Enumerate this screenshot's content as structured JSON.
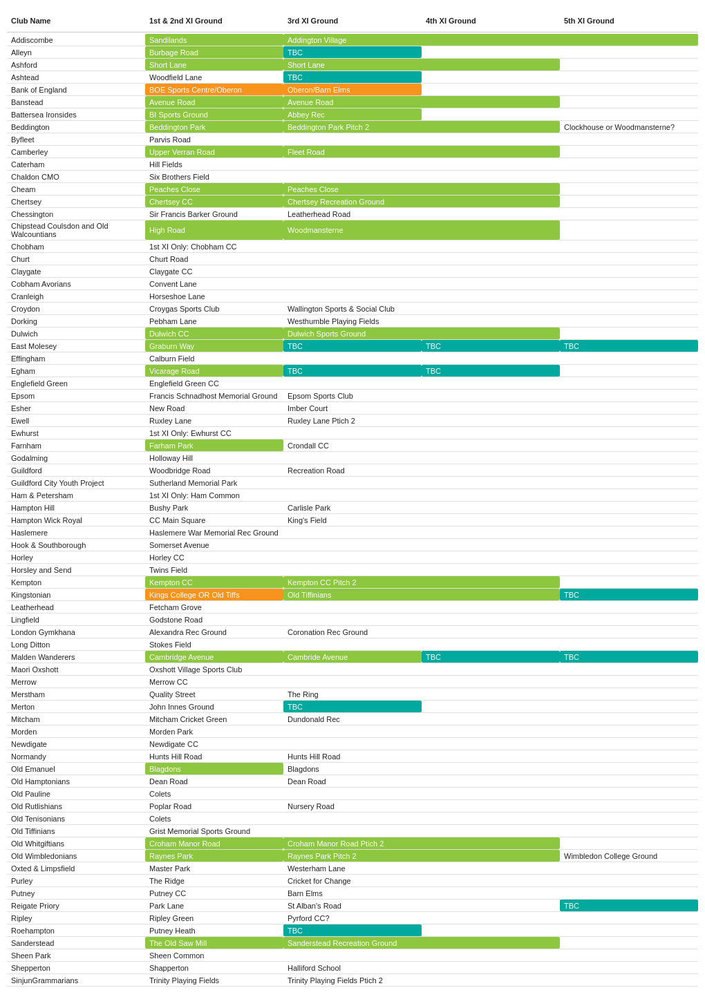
{
  "header": {
    "col1": "Club Name",
    "col2": "1st & 2nd XI Ground",
    "col3": "3rd XI Ground",
    "col4": "4th XI Ground",
    "col5": "5th XI Ground"
  },
  "rows": [
    {
      "club": "Addiscombe",
      "g1": "Sandilands",
      "g1c": "green",
      "g2": "Addington Village",
      "g2c": "green",
      "g2span": 3
    },
    {
      "club": "Alleyn",
      "g1": "Burbage Road",
      "g1c": "green",
      "g2": "TBC",
      "g2c": "teal"
    },
    {
      "club": "Ashford",
      "g1": "Short Lane",
      "g1c": "green",
      "g2": "Short Lane",
      "g2c": "green",
      "g2span": 2
    },
    {
      "club": "Ashtead",
      "g1": "Woodfield Lane",
      "g2": "TBC",
      "g2c": "teal"
    },
    {
      "club": "Bank of England",
      "g1": "BOE Sports Centre/Oberon",
      "g1c": "orange",
      "g2": "Oberon/Barn Elms",
      "g2c": "orange"
    },
    {
      "club": "Banstead",
      "g1": "Avenue Road",
      "g1c": "green",
      "g2": "Avenue Road",
      "g2c": "green",
      "g2span": 2
    },
    {
      "club": "Battersea Ironsides",
      "g1": "BI Sports Ground",
      "g1c": "green",
      "g2": "Abbey Rec",
      "g2c": "green"
    },
    {
      "club": "Beddington",
      "g1": "Beddington Park",
      "g1c": "green",
      "g2": "Beddington Park Pitch 2",
      "g2c": "green",
      "g2span": 2,
      "g3": "Clockhouse or Woodmansterne?",
      "g3c": ""
    },
    {
      "club": "Byfleet",
      "g1": "Parvis Road"
    },
    {
      "club": "Camberley",
      "g1": "Upper Verran Road",
      "g1c": "green",
      "g2": "Fleet Road",
      "g2c": "green",
      "g2span": 2
    },
    {
      "club": "Caterham",
      "g1": "Hill Fields"
    },
    {
      "club": "Chaldon CMO",
      "g1": "Six Brothers Field"
    },
    {
      "club": "Cheam",
      "g1": "Peaches Close",
      "g1c": "green",
      "g2": "Peaches Close",
      "g2c": "green",
      "g2span": 2
    },
    {
      "club": "Chertsey",
      "g1": "Chertsey CC",
      "g1c": "green",
      "g2": "Chertsey Recreation Ground",
      "g2c": "green",
      "g2span": 2
    },
    {
      "club": "Chessington",
      "g1": "Sir Francis Barker Ground",
      "g2": "Leatherhead Road"
    },
    {
      "club": "Chipstead Coulsdon and Old Walcountians",
      "g1": "High Road",
      "g1c": "green",
      "g2": "Woodmansterne",
      "g2c": "green",
      "g2span": 2
    },
    {
      "club": "Chobham",
      "g1": "1st XI Only: Chobham CC"
    },
    {
      "club": "Churt",
      "g1": "Churt Road"
    },
    {
      "club": "Claygate",
      "g1": "Claygate CC"
    },
    {
      "club": "Cobham Avorians",
      "g1": "Convent Lane"
    },
    {
      "club": "Cranleigh",
      "g1": "Horseshoe Lane"
    },
    {
      "club": "Croydon",
      "g1": "Croygas Sports Club",
      "g2": "Wallington Sports & Social Club"
    },
    {
      "club": "Dorking",
      "g1": "Pebham Lane",
      "g2": "Westhumble Playing Fields"
    },
    {
      "club": "Dulwich",
      "g1": "Dulwich CC",
      "g1c": "green",
      "g2": "Dulwich Sports Ground",
      "g2c": "green",
      "g2span": 2
    },
    {
      "club": "East Molesey",
      "g1": "Graburn Way",
      "g1c": "green",
      "g2": "TBC",
      "g2c": "teal",
      "g3": "TBC",
      "g3c": "teal",
      "g4": "TBC",
      "g4c": "teal"
    },
    {
      "club": "Effingham",
      "g1": "Calburn Field"
    },
    {
      "club": "Egham",
      "g1": "Vicarage Road",
      "g1c": "green",
      "g2": "TBC",
      "g2c": "teal",
      "g3": "TBC",
      "g3c": "teal"
    },
    {
      "club": "Englefield Green",
      "g1": "Englefield Green CC"
    },
    {
      "club": "Epsom",
      "g1": "Francis Schnadhost Memorial Ground",
      "g2": "Epsom Sports Club"
    },
    {
      "club": "Esher",
      "g1": "New Road",
      "g2": "Imber Court",
      "g2span": 2
    },
    {
      "club": "Ewell",
      "g1": "Ruxley Lane",
      "g2": "Ruxley Lane Ptich 2"
    },
    {
      "club": "Ewhurst",
      "g1": "1st XI Only: Ewhurst CC"
    },
    {
      "club": "Farnham",
      "g1": "Farham Park",
      "g1c": "green",
      "g2": "Crondall CC"
    },
    {
      "club": "Godalming",
      "g1": "Holloway Hill"
    },
    {
      "club": "Guildford",
      "g1": "Woodbridge Road",
      "g2": "Recreation Road"
    },
    {
      "club": "Guildford City Youth Project",
      "g1": "Sutherland Memorial Park"
    },
    {
      "club": "Ham & Petersham",
      "g1": "1st XI Only: Ham Common"
    },
    {
      "club": "Hampton Hill",
      "g1": "Bushy Park",
      "g2": "Carlisle Park",
      "g2span": 2
    },
    {
      "club": "Hampton Wick Royal",
      "g1": "CC Main Square",
      "g2": "King's Field"
    },
    {
      "club": "Haslemere",
      "g1": "Haslemere War Memorial Rec Ground"
    },
    {
      "club": "Hook & Southborough",
      "g1": "Somerset Avenue"
    },
    {
      "club": "Horley",
      "g1": "Horley CC"
    },
    {
      "club": "Horsley and Send",
      "g1": "Twins Field"
    },
    {
      "club": "Kempton",
      "g1": "Kempton CC",
      "g1c": "green",
      "g2": "Kempton CC Pitch 2",
      "g2c": "green",
      "g2span": 2
    },
    {
      "club": "Kingstonian",
      "g1": "Kings College OR Old Tiffs",
      "g1c": "orange",
      "g2": "Old Tiffinians",
      "g2c": "green",
      "g2span": 2,
      "g3": "TBC",
      "g3c": "teal"
    },
    {
      "club": "Leatherhead",
      "g1": "Fetcham Grove"
    },
    {
      "club": "Lingfield",
      "g1": "Godstone Road"
    },
    {
      "club": "London Gymkhana",
      "g1": "Alexandra Rec Ground",
      "g2": "Coronation Rec Ground"
    },
    {
      "club": "Long Ditton",
      "g1": "Stokes Field"
    },
    {
      "club": "Malden Wanderers",
      "g1": "Cambridge Avenue",
      "g1c": "green",
      "g2": "Cambride Avenue",
      "g2c": "green",
      "g3": "TBC",
      "g3c": "teal",
      "g4": "TBC",
      "g4c": "teal"
    },
    {
      "club": "Maori Oxshott",
      "g1": "Oxshott Village Sports Club"
    },
    {
      "club": "Merrow",
      "g1": "Merrow CC"
    },
    {
      "club": "Merstham",
      "g1": "Quality Street",
      "g2": "The Ring",
      "g2span": 2
    },
    {
      "club": "Merton",
      "g1": "John Innes Ground",
      "g2": "TBC",
      "g2c": "teal"
    },
    {
      "club": "Mitcham",
      "g1": "Mitcham Cricket Green",
      "g2": "Dundonald Rec"
    },
    {
      "club": "Morden",
      "g1": "Morden Park"
    },
    {
      "club": "Newdigate",
      "g1": "Newdigate CC"
    },
    {
      "club": "Normandy",
      "g1": "Hunts Hill Road",
      "g2": "Hunts Hill Road",
      "g2span": 2
    },
    {
      "club": "Old Emanuel",
      "g1": "Blagdons",
      "g1c": "green",
      "g2": "Blagdons"
    },
    {
      "club": "Old Hamptonians",
      "g1": "Dean Road",
      "g2": "Dean Road",
      "g2span": 2
    },
    {
      "club": "Old Pauline",
      "g1": "Colets"
    },
    {
      "club": "Old Rutlishians",
      "g1": "Poplar Road",
      "g2": "Nursery Road",
      "g2span": 2
    },
    {
      "club": "Old Tenisonians",
      "g1": "Colets"
    },
    {
      "club": "Old Tiffinians",
      "g1": "Grist Memorial Sports Ground"
    },
    {
      "club": "Old Whitgiftians",
      "g1": "Croham Manor Road",
      "g1c": "green",
      "g2": "Croham Manor Road Ptich 2",
      "g2c": "green",
      "g2span": 2
    },
    {
      "club": "Old Wimbledonians",
      "g1": "Raynes Park",
      "g1c": "green",
      "g2": "Raynes Park Pitch 2",
      "g2c": "green",
      "g2span": 2,
      "g3": "Wimbledon College Ground"
    },
    {
      "club": "Oxted & Limpsfield",
      "g1": "Master Park",
      "g2": "Westerham Lane"
    },
    {
      "club": "Purley",
      "g1": "The Ridge",
      "g2": "Cricket for Change",
      "g2span": 2
    },
    {
      "club": "Putney",
      "g1": "Putney CC",
      "g2": "Barn Elms"
    },
    {
      "club": "Reigate Priory",
      "g1": "Park Lane",
      "g2": "St Alban's Road",
      "g2span": 2,
      "g3": "TBC",
      "g3c": "teal"
    },
    {
      "club": "Ripley",
      "g1": "Ripley Green",
      "g2": "Pyrford CC?"
    },
    {
      "club": "Roehampton",
      "g1": "Putney Heath",
      "g2": "TBC",
      "g2c": "teal"
    },
    {
      "club": "Sanderstead",
      "g1": "The Old Saw Mill",
      "g1c": "green",
      "g2": "Sanderstead Recreation Ground",
      "g2c": "green",
      "g2span": 2
    },
    {
      "club": "Sheen Park",
      "g1": "Sheen Common"
    },
    {
      "club": "Shepperton",
      "g1": "Shapperton",
      "g2": "Halliford School"
    },
    {
      "club": "SinjunGrammarians",
      "g1": "Trinity Playing Fields",
      "g2": "Trinity Playing Fields Ptich 2",
      "g2span": 2
    }
  ]
}
